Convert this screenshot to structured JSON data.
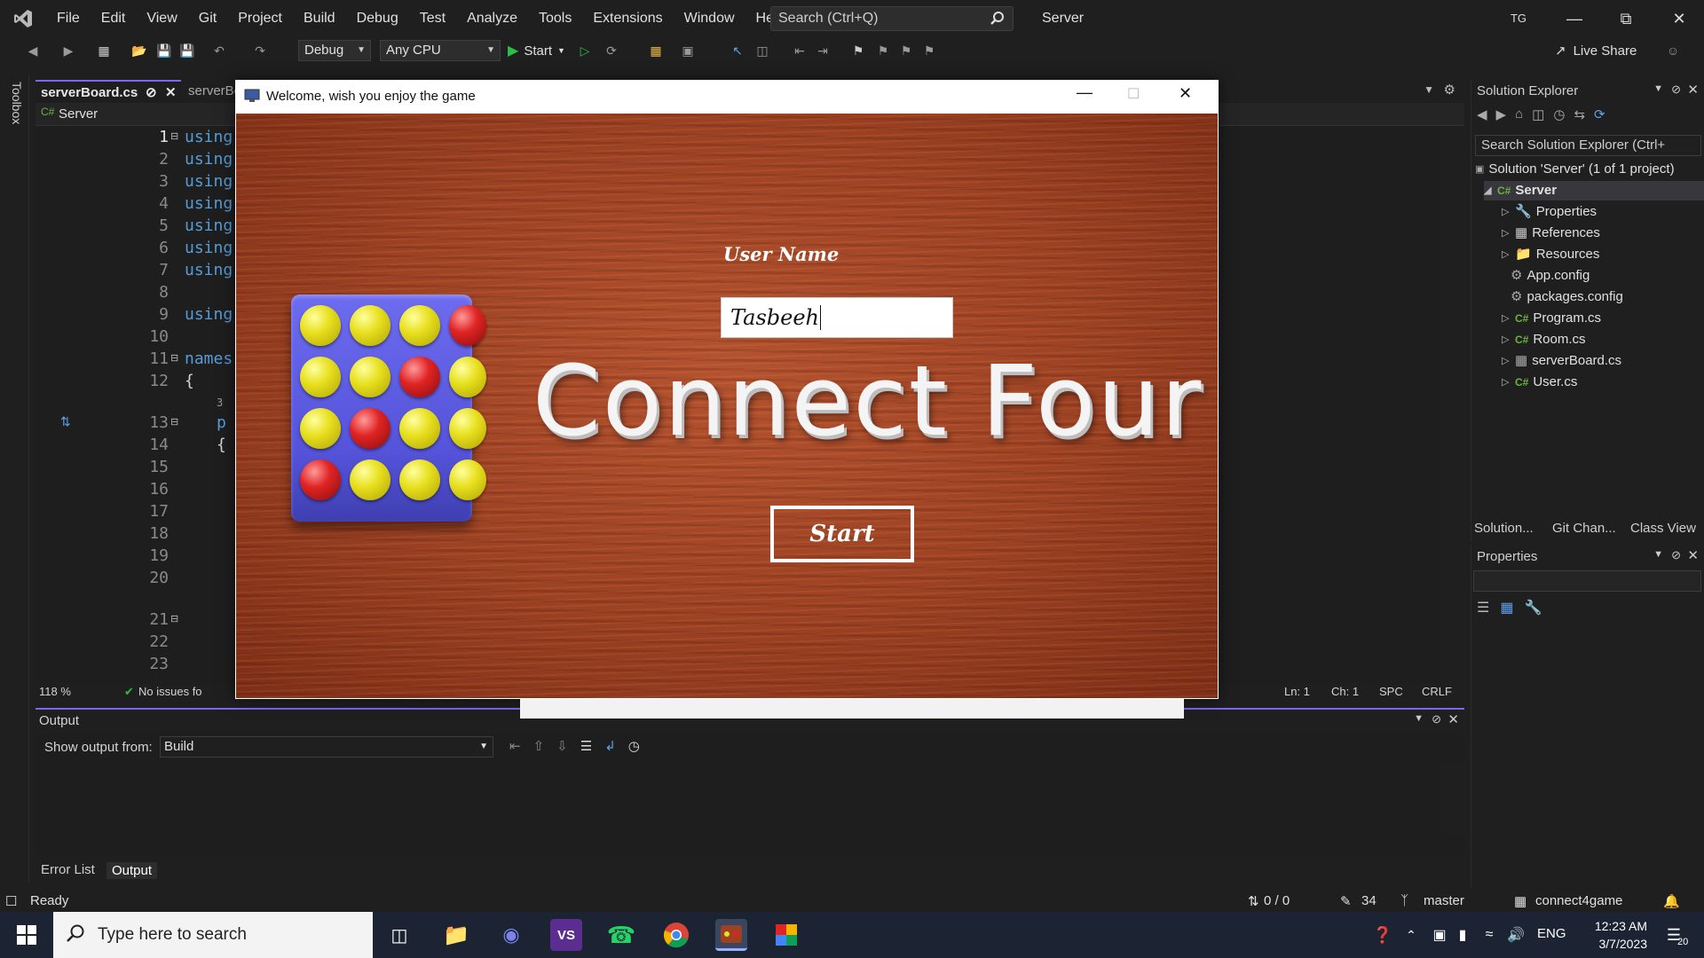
{
  "menu": {
    "items": [
      "File",
      "Edit",
      "View",
      "Git",
      "Project",
      "Build",
      "Debug",
      "Test",
      "Analyze",
      "Tools",
      "Extensions",
      "Window",
      "Help"
    ],
    "search_placeholder": "Search (Ctrl+Q)",
    "solution_name": "Server",
    "user_initials": "TG"
  },
  "toolbar": {
    "config": "Debug",
    "platform": "Any CPU",
    "start_label": "Start",
    "live_share": "Live Share"
  },
  "toolbox_label": "Toolbox",
  "editor": {
    "tabs": [
      "serverBoard.cs",
      "serverBo"
    ],
    "nav_project": "Server",
    "lines": [
      "1",
      "2",
      "3",
      "4",
      "5",
      "6",
      "7",
      "8",
      "9",
      "10",
      "11",
      "12",
      "13",
      "14",
      "15",
      "16",
      "17",
      "18",
      "19",
      "20",
      "21",
      "22",
      "23"
    ],
    "code_tokens": [
      "using",
      "using",
      "using",
      "using",
      "using",
      "using",
      "using",
      "using",
      "names",
      "{",
      "p",
      "{"
    ],
    "ref_count": "3",
    "zoom": "118 %",
    "issues": "No issues fo",
    "ln": "Ln: 1",
    "ch": "Ch: 1",
    "spc": "SPC",
    "crlf": "CRLF"
  },
  "solution_explorer": {
    "title": "Solution Explorer",
    "search_placeholder": "Search Solution Explorer (Ctrl+",
    "solution": "Solution 'Server' (1 of 1 project)",
    "project": "Server",
    "items": [
      "Properties",
      "References",
      "Resources",
      "App.config",
      "packages.config",
      "Program.cs",
      "Room.cs",
      "serverBoard.cs",
      "User.cs"
    ],
    "bottom_tabs": [
      "Solution...",
      "Git Chan...",
      "Class View"
    ]
  },
  "properties": {
    "title": "Properties"
  },
  "output": {
    "title": "Output",
    "show_from_label": "Show output from:",
    "source": "Build",
    "tabs": [
      "Error List",
      "Output"
    ]
  },
  "statusbar": {
    "ready": "Ready",
    "changes": "0 / 0",
    "pencil_count": "34",
    "branch": "master",
    "repo": "connect4game"
  },
  "taskbar": {
    "search_placeholder": "Type here to search",
    "lang": "ENG",
    "time": "12:23 AM",
    "date": "3/7/2023",
    "notif_count": "20"
  },
  "game": {
    "window_title": "Welcome, wish you enjoy the game",
    "user_label": "User Name",
    "user_value": "Tasbeeh",
    "big_title": "Connect Four",
    "start_button": "Start",
    "board": [
      [
        "y",
        "y",
        "y",
        "r"
      ],
      [
        "y",
        "y",
        "r",
        "y"
      ],
      [
        "y",
        "r",
        "y",
        "y"
      ],
      [
        "r",
        "y",
        "y",
        "y"
      ]
    ]
  },
  "colors": {
    "accent": "#7b68ee",
    "ide_bg": "#1f1f1f",
    "wood": "#9c4122",
    "board": "#5453d9",
    "yellow_ball": "#e8e020",
    "red_ball": "#e02424"
  }
}
